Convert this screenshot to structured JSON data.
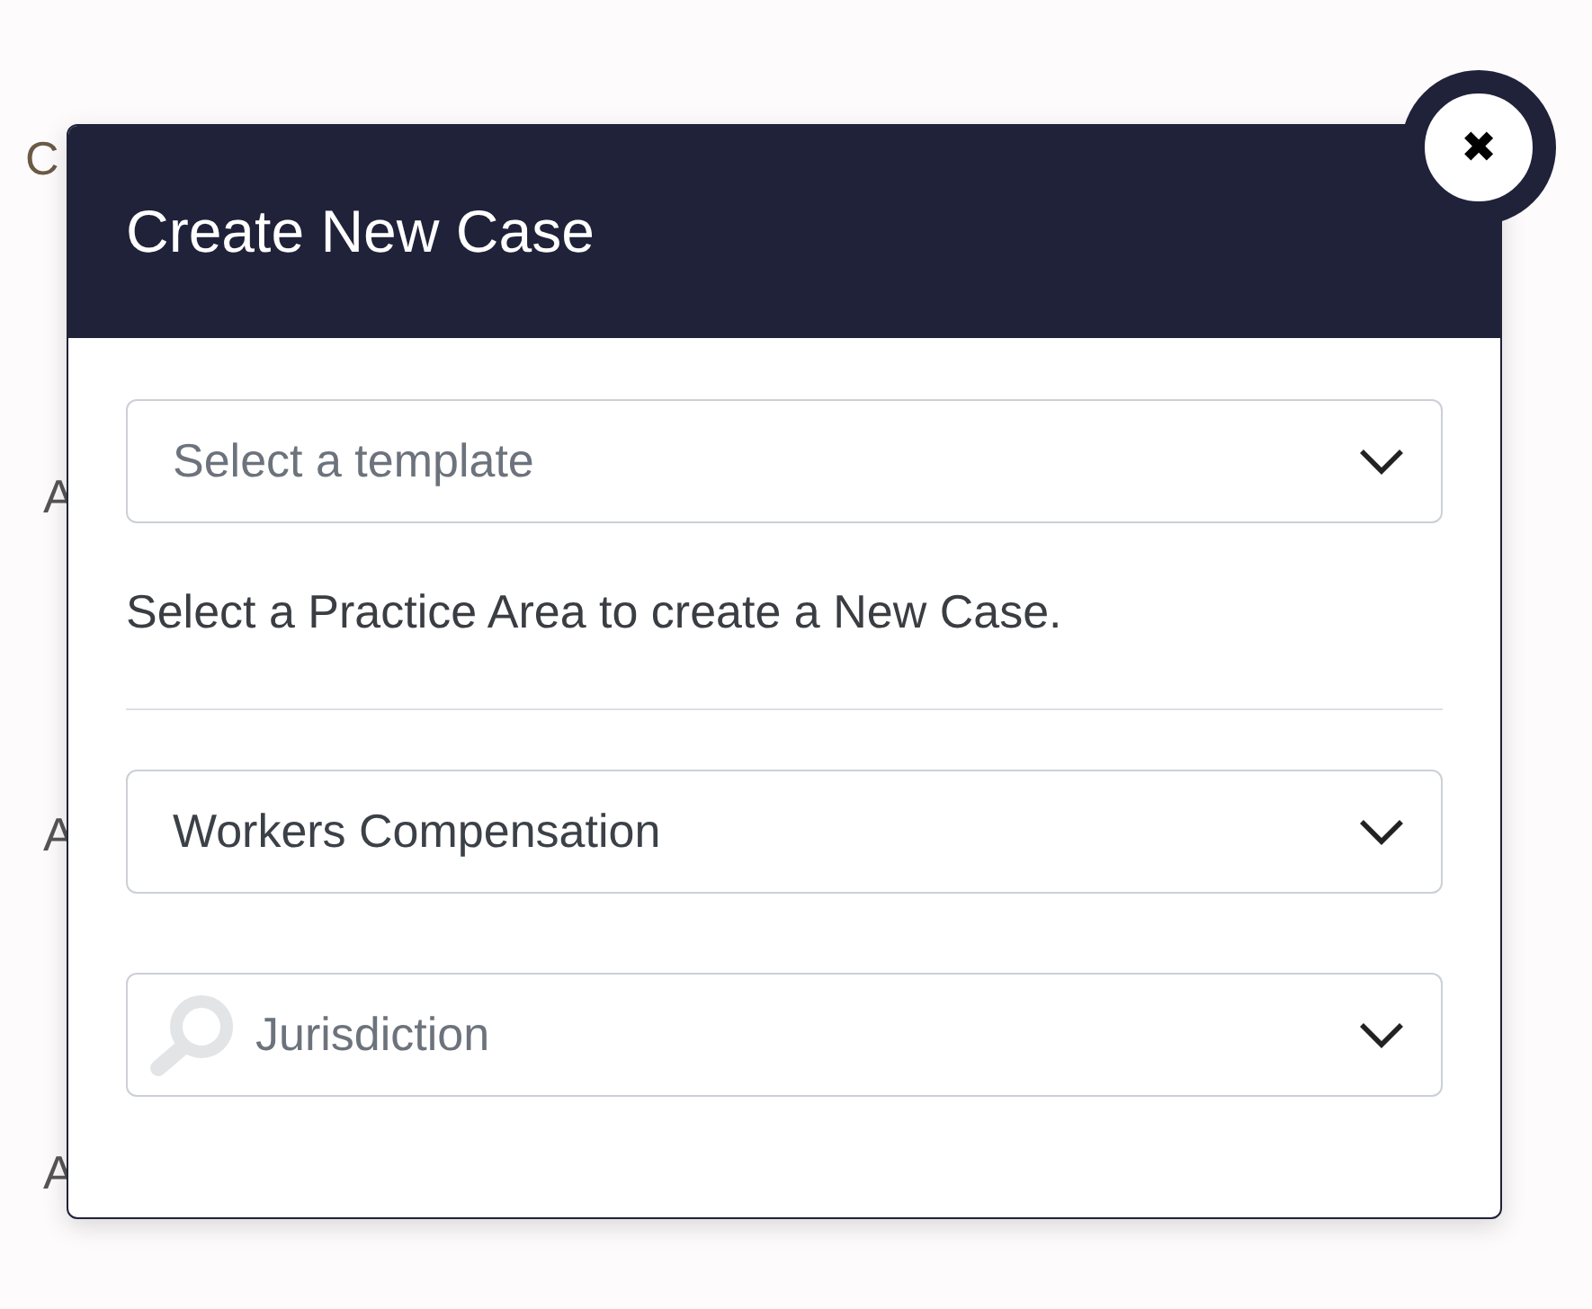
{
  "background": {
    "heading": "C",
    "rows": [
      "A",
      "A",
      "A"
    ]
  },
  "modal": {
    "title": "Create New Case",
    "close_label": "✖",
    "template_select": {
      "placeholder": "Select a template"
    },
    "instruction": "Select a Practice Area to create a New Case.",
    "practice_area_select": {
      "value": "Workers Compensation"
    },
    "jurisdiction_select": {
      "placeholder": "Jurisdiction"
    }
  }
}
